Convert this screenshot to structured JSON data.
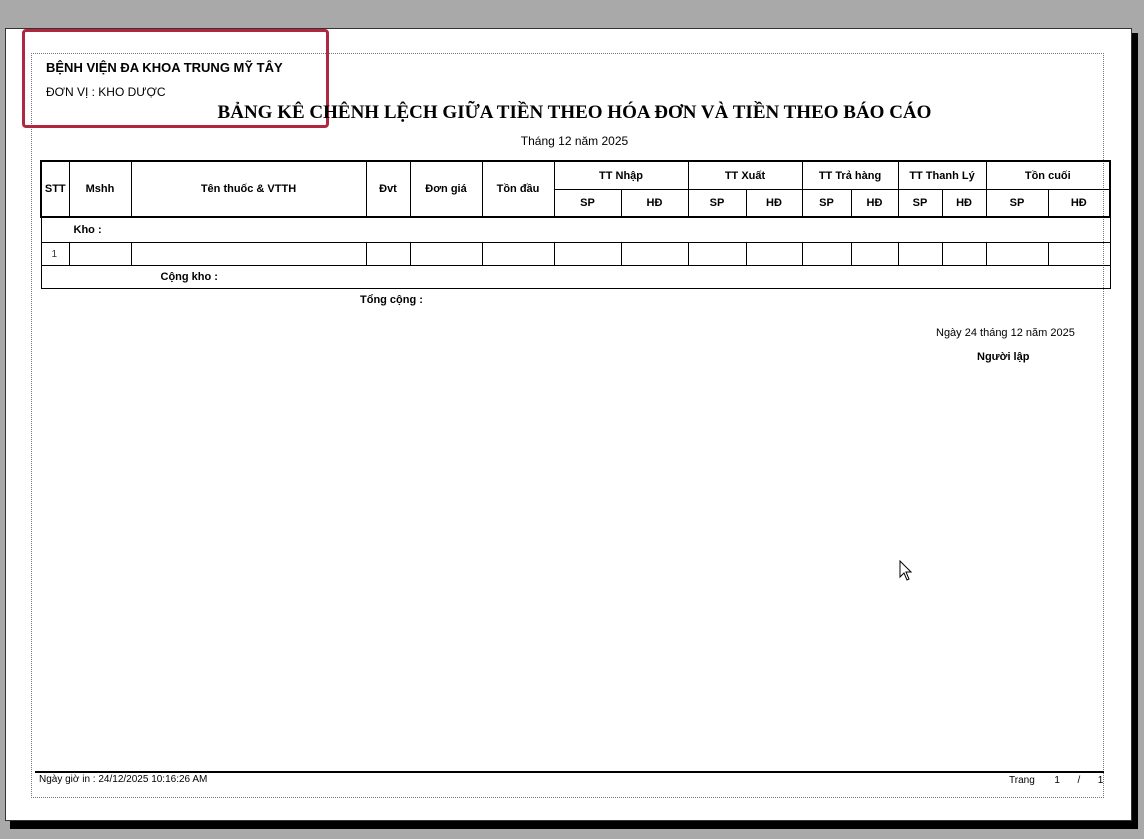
{
  "report": {
    "hospital": "BỆNH VIỆN ĐA KHOA TRUNG MỸ TÂY",
    "unit": "ĐƠN VỊ : KHO DƯỢC",
    "title": "BẢNG KÊ CHÊNH LỆCH GIỮA TIỀN THEO HÓA ĐƠN VÀ TIỀN THEO BÁO CÁO",
    "subtitle": "Tháng 12 năm 2025"
  },
  "table": {
    "headers": {
      "stt": "STT",
      "mshh": "Mshh",
      "ten": "Tên thuốc & VTTH",
      "dvt": "Đvt",
      "dongia": "Đơn giá",
      "tondau": "Tồn đầu",
      "nhap": "TT Nhập",
      "xuat": "TT Xuất",
      "trahang": "TT Trả hàng",
      "thanhly": "TT Thanh Lý",
      "toncuoi": "Tồn cuối",
      "sp": "SP",
      "hd": "HĐ"
    },
    "kho_label": "Kho :",
    "row_stt": "1",
    "cong_kho": "Cộng kho :"
  },
  "tong_cong": "Tổng cộng :",
  "signature": {
    "date": "Ngày 24 tháng 12 năm 2025",
    "role": "Người lập"
  },
  "footer": {
    "print_time": "Ngày giờ in : 24/12/2025 10:16:26 AM",
    "page_label": "Trang",
    "page_current": "1",
    "page_sep": "/",
    "page_total": "1"
  }
}
